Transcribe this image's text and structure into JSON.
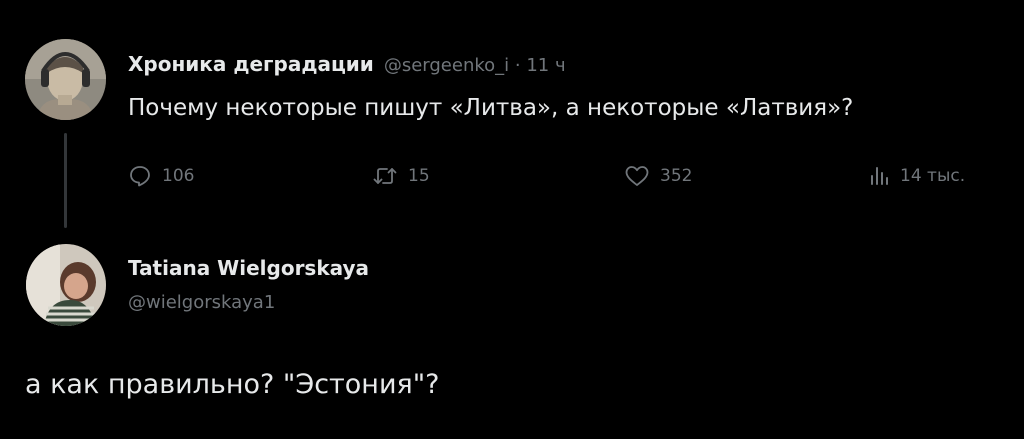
{
  "tweet1": {
    "author_name": "Хроника деградации",
    "handle": "@sergeenko_i",
    "separator": " · ",
    "time": "11 ч",
    "text": "Почему некоторые пишут «Литва», а некоторые «Латвия»?",
    "actions": {
      "replies": "106",
      "retweets": "15",
      "likes": "352",
      "views": "14 тыс."
    }
  },
  "tweet2": {
    "author_name": "Tatiana Wielgorskaya",
    "handle": "@wielgorskaya1",
    "text": "а как правильно? \"Эстония\"?"
  },
  "colors": {
    "background": "#000000",
    "text": "#e7e9ea",
    "muted": "#71767b",
    "thread_line": "#333639"
  },
  "icons": [
    "reply-icon",
    "retweet-icon",
    "like-icon",
    "views-icon"
  ]
}
